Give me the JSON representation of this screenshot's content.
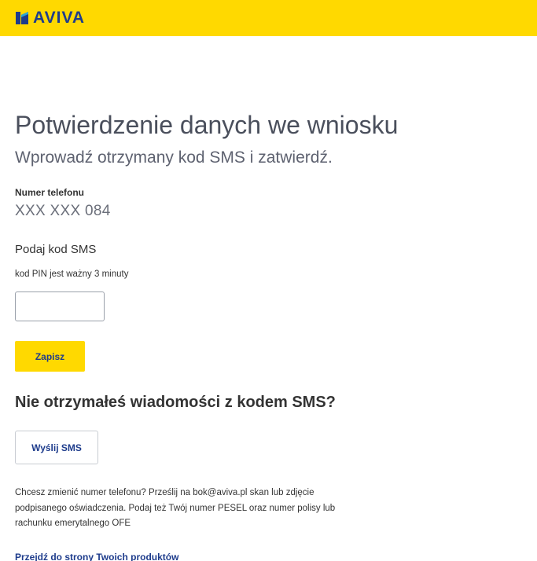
{
  "header": {
    "logo_text": "AVIVA",
    "background_color": "#ffd900",
    "brand_color": "#1e3c8c"
  },
  "page": {
    "title": "Potwierdzenie danych we wniosku",
    "subtitle": "Wprowadź otrzymany kod SMS i zatwierdź."
  },
  "phone": {
    "label": "Numer telefonu",
    "value": "XXX XXX 084"
  },
  "sms_code": {
    "label": "Podaj kod SMS",
    "hint": "kod PIN jest ważny 3 minuty",
    "value": "",
    "placeholder": ""
  },
  "buttons": {
    "save_label": "Zapisz",
    "resend_label": "Wyślij SMS"
  },
  "resend": {
    "heading": "Nie otrzymałeś wiadomości z kodem SMS?"
  },
  "info": {
    "text": "Chcesz zmienić numer telefonu? Prześlij na bok@aviva.pl skan lub zdjęcie podpisanego oświadczenia. Podaj też Twój numer PESEL oraz numer polisy lub rachunku emerytalnego OFE"
  },
  "links": {
    "products_label": "Przejdź do strony Twoich produktów"
  }
}
